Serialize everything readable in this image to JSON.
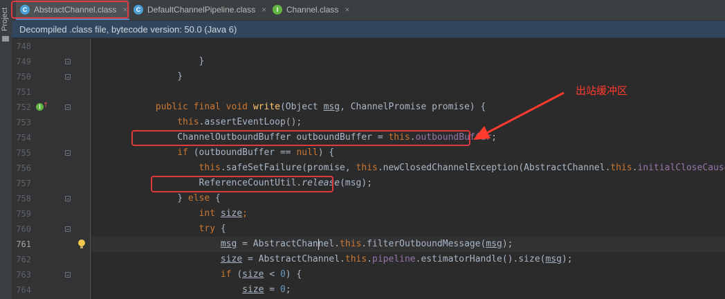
{
  "sidebar": {
    "project_label": "Project"
  },
  "tabs": [
    {
      "label": "AbstractChannel.class",
      "icon": "class-file-icon",
      "icon_glyph": "C",
      "icon_color": "#4a9fd5",
      "active": true
    },
    {
      "label": "DefaultChannelPipeline.class",
      "icon": "class-file-icon",
      "icon_glyph": "C",
      "icon_color": "#4a9fd5",
      "active": false
    },
    {
      "label": "Channel.class",
      "icon": "interface-file-icon",
      "icon_glyph": "I",
      "icon_color": "#62b543",
      "active": false
    }
  ],
  "tab_close_glyph": "×",
  "infobar": {
    "text": "Decompiled .class file, bytecode version: 50.0 (Java 6)"
  },
  "gutter": {
    "line_numbers": [
      "748",
      "749",
      "750",
      "751",
      "752",
      "753",
      "754",
      "755",
      "756",
      "757",
      "758",
      "759",
      "760",
      "761",
      "762",
      "763",
      "764"
    ],
    "current_line": "761"
  },
  "annotation": {
    "text": "出站缓冲区",
    "color": "#ff3b30"
  },
  "colors": {
    "keyword": "#cc7832",
    "method_decl": "#ffc66d",
    "field": "#9876aa",
    "number": "#6897bb",
    "text": "#a9b7c6",
    "highlight_box": "#e0393e"
  },
  "code": {
    "l749": "}",
    "l750": "}",
    "l752": {
      "kw1": "public final void ",
      "fn": "write",
      "p1": "(Object ",
      "msg": "msg",
      "p2": ", ChannelPromise promise) {"
    },
    "l753": {
      "kw": "this",
      "rest": ".assertEventLoop();"
    },
    "l754": {
      "a": "ChannelOutboundBuffer outboundBuffer = ",
      "kw": "this",
      "dot": ".",
      "fld": "outboundBuffer",
      "end": ";"
    },
    "l755": {
      "kw1": "if",
      "a": " (outboundBuffer == ",
      "kw2": "null",
      "b": ") {"
    },
    "l756": {
      "kw1": "this",
      "a": ".safeSetFailure(promise, ",
      "kw2": "this",
      "b": ".newClosedChannelException(AbstractChannel.",
      "kw3": "this",
      "dot": ".",
      "fld": "initialCloseCause",
      "end": ");"
    },
    "l757": {
      "a": "ReferenceCountUtil.",
      "it": "release",
      "b": "(msg);"
    },
    "l758": {
      "a": "} ",
      "kw": "else",
      "b": " {"
    },
    "l759": {
      "kw": "int ",
      "v": "size",
      "end": ";"
    },
    "l760": {
      "kw": "try",
      "b": " {"
    },
    "l761": {
      "v": "msg",
      "a": " = AbstractChannel.",
      "kw": "this",
      "b": ".filterOutboundMessage(",
      "v2": "msg",
      "end": ");"
    },
    "l762": {
      "v": "size",
      "a": " = AbstractChannel.",
      "kw": "this",
      "dot": ".",
      "fld": "pipeline",
      "b": ".estimatorHandle().size(",
      "v2": "msg",
      "end": ");"
    },
    "l763": {
      "kw": "if",
      "a": " (",
      "v": "size",
      "b": " < ",
      "num": "0",
      "c": ") {"
    },
    "l764": {
      "v": "size",
      "a": " = ",
      "num": "0",
      "end": ";"
    }
  }
}
